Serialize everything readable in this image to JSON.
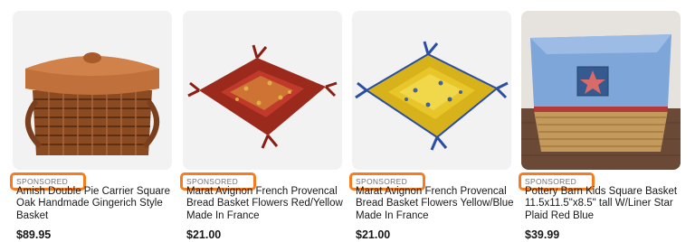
{
  "products": [
    {
      "sponsored": "SPONSORED",
      "title": "Amish Double Pie Carrier Square Oak Handmade Gingerich Style Basket",
      "price": "$89.95",
      "image_icon": "wooden-basket-with-lid-image"
    },
    {
      "sponsored": "SPONSORED",
      "title": "Marat Avignon French Provencal Bread Basket Flowers Red/Yellow Made In France",
      "price": "$21.00",
      "image_icon": "red-fabric-bread-basket-image"
    },
    {
      "sponsored": "SPONSORED",
      "title": "Marat Avignon French Provencal Bread Basket Flowers Yellow/Blue Made In France",
      "price": "$21.00",
      "image_icon": "yellow-fabric-bread-basket-image"
    },
    {
      "sponsored": "SPONSORED",
      "title": "Pottery Barn Kids Square Basket 11.5x11.5\"x8.5\" tall W/Liner Star Plaid Red Blue",
      "price": "$39.99",
      "image_icon": "wicker-basket-with-blue-liner-image"
    }
  ],
  "colors": {
    "sponsored_outline": "#f57c1f",
    "thumb_background": "#f2f2f2"
  }
}
